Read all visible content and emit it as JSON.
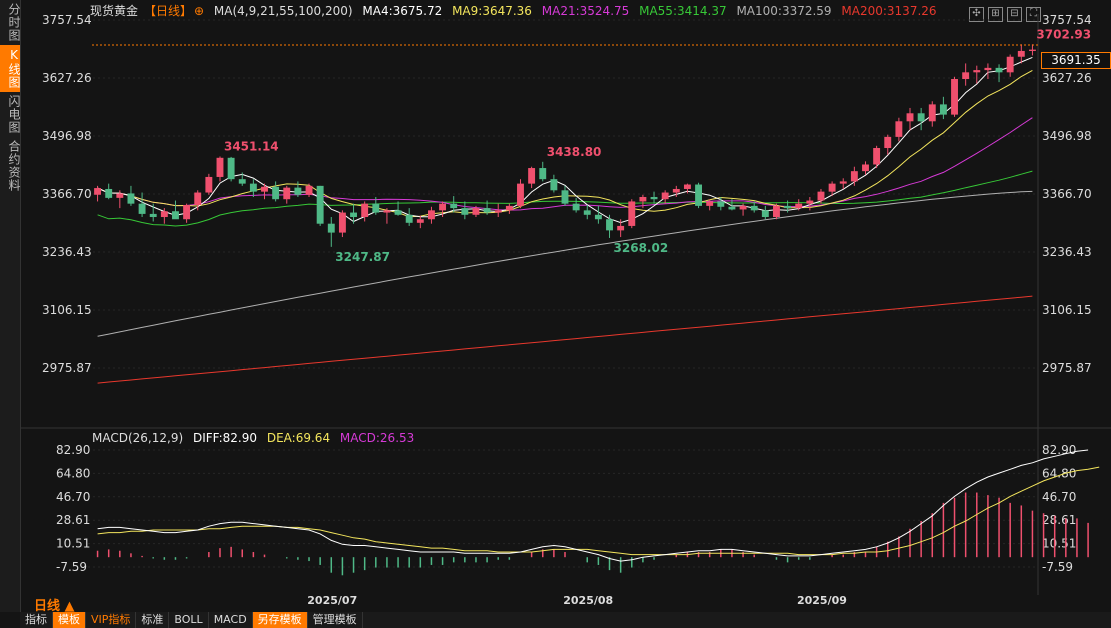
{
  "sidebar": {
    "tabs": [
      "分时图",
      "K线图",
      "闪电图",
      "合约资料"
    ],
    "active": 1
  },
  "header": {
    "symbol": "现货黄金",
    "period_tag": "【日线】",
    "ma_params": "MA(4,9,21,55,100,200)",
    "ma4": "MA4:3675.72",
    "ma9": "MA9:3647.36",
    "ma21": "MA21:3524.75",
    "ma55": "MA55:3414.37",
    "ma100": "MA100:3372.59",
    "ma200": "MA200:3137.26"
  },
  "macd_header": {
    "label": "MACD(26,12,9)",
    "diff": "DIFF:82.90",
    "dea": "DEA:69.64",
    "macd": "MACD:26.53"
  },
  "current_price": "3691.35",
  "period_label": "日线 ▲",
  "bottom_tabs": [
    "指标",
    "模板",
    "VIP指标",
    "标准",
    "BOLL",
    "MACD",
    "另存模板",
    "管理模板"
  ],
  "colors": {
    "up": "#f0506e",
    "down": "#4fb987",
    "ma4": "#ffffff",
    "ma9": "#f3e55d",
    "ma21": "#d63ad6",
    "ma55": "#37c837",
    "ma100": "#b0b0b0",
    "ma200": "#e8382d",
    "accent": "#ff7a00"
  },
  "chart_data": {
    "type": "candlestick",
    "y_ticks": [
      "3757.54",
      "3627.26",
      "3496.98",
      "3366.70",
      "3236.43",
      "3106.15",
      "2975.87"
    ],
    "x_labels": [
      {
        "label": "2025/07",
        "index": 21
      },
      {
        "label": "2025/08",
        "index": 44
      },
      {
        "label": "2025/09",
        "index": 65
      }
    ],
    "ylim": [
      2975.87,
      3757.54
    ],
    "ohlc": [
      [
        3365,
        3385,
        3350,
        3380
      ],
      [
        3378,
        3390,
        3355,
        3358
      ],
      [
        3358,
        3375,
        3335,
        3368
      ],
      [
        3368,
        3385,
        3340,
        3345
      ],
      [
        3345,
        3370,
        3315,
        3322
      ],
      [
        3322,
        3345,
        3305,
        3315
      ],
      [
        3315,
        3335,
        3300,
        3328
      ],
      [
        3328,
        3352,
        3315,
        3310
      ],
      [
        3310,
        3345,
        3302,
        3342
      ],
      [
        3342,
        3375,
        3330,
        3370
      ],
      [
        3370,
        3412,
        3365,
        3405
      ],
      [
        3405,
        3451,
        3395,
        3448
      ],
      [
        3448,
        3450,
        3395,
        3400
      ],
      [
        3400,
        3415,
        3385,
        3390
      ],
      [
        3390,
        3400,
        3360,
        3372
      ],
      [
        3372,
        3390,
        3355,
        3383
      ],
      [
        3383,
        3395,
        3350,
        3355
      ],
      [
        3355,
        3385,
        3345,
        3381
      ],
      [
        3381,
        3395,
        3360,
        3365
      ],
      [
        3365,
        3390,
        3360,
        3385
      ],
      [
        3385,
        3385,
        3295,
        3300
      ],
      [
        3300,
        3315,
        3248,
        3280
      ],
      [
        3280,
        3330,
        3270,
        3325
      ],
      [
        3325,
        3345,
        3300,
        3315
      ],
      [
        3315,
        3350,
        3305,
        3345
      ],
      [
        3345,
        3360,
        3320,
        3325
      ],
      [
        3325,
        3335,
        3300,
        3330
      ],
      [
        3330,
        3350,
        3318,
        3320
      ],
      [
        3320,
        3335,
        3295,
        3302
      ],
      [
        3302,
        3318,
        3290,
        3310
      ],
      [
        3310,
        3338,
        3300,
        3330
      ],
      [
        3330,
        3350,
        3315,
        3345
      ],
      [
        3345,
        3362,
        3325,
        3335
      ],
      [
        3335,
        3350,
        3310,
        3320
      ],
      [
        3320,
        3340,
        3315,
        3335
      ],
      [
        3335,
        3352,
        3320,
        3325
      ],
      [
        3325,
        3345,
        3315,
        3330
      ],
      [
        3330,
        3345,
        3322,
        3340
      ],
      [
        3340,
        3400,
        3335,
        3390
      ],
      [
        3390,
        3428,
        3380,
        3425
      ],
      [
        3425,
        3439,
        3395,
        3400
      ],
      [
        3400,
        3410,
        3370,
        3375
      ],
      [
        3375,
        3385,
        3340,
        3345
      ],
      [
        3345,
        3358,
        3325,
        3330
      ],
      [
        3330,
        3342,
        3310,
        3320
      ],
      [
        3320,
        3340,
        3300,
        3310
      ],
      [
        3310,
        3320,
        3268,
        3285
      ],
      [
        3285,
        3310,
        3270,
        3295
      ],
      [
        3295,
        3355,
        3290,
        3350
      ],
      [
        3350,
        3365,
        3335,
        3360
      ],
      [
        3360,
        3372,
        3345,
        3355
      ],
      [
        3355,
        3375,
        3345,
        3370
      ],
      [
        3370,
        3385,
        3360,
        3378
      ],
      [
        3378,
        3390,
        3368,
        3388
      ],
      [
        3388,
        3392,
        3335,
        3340
      ],
      [
        3340,
        3355,
        3330,
        3350
      ],
      [
        3350,
        3360,
        3330,
        3338
      ],
      [
        3338,
        3355,
        3330,
        3332
      ],
      [
        3332,
        3345,
        3318,
        3340
      ],
      [
        3340,
        3350,
        3325,
        3330
      ],
      [
        3330,
        3340,
        3310,
        3315
      ],
      [
        3315,
        3345,
        3310,
        3340
      ],
      [
        3340,
        3352,
        3325,
        3335
      ],
      [
        3335,
        3355,
        3330,
        3345
      ],
      [
        3345,
        3360,
        3330,
        3352
      ],
      [
        3352,
        3378,
        3345,
        3372
      ],
      [
        3372,
        3395,
        3362,
        3390
      ],
      [
        3390,
        3402,
        3378,
        3395
      ],
      [
        3395,
        3428,
        3385,
        3418
      ],
      [
        3418,
        3440,
        3410,
        3433
      ],
      [
        3433,
        3475,
        3425,
        3470
      ],
      [
        3470,
        3500,
        3455,
        3495
      ],
      [
        3495,
        3538,
        3485,
        3530
      ],
      [
        3530,
        3560,
        3510,
        3548
      ],
      [
        3548,
        3560,
        3510,
        3530
      ],
      [
        3530,
        3575,
        3518,
        3568
      ],
      [
        3568,
        3585,
        3535,
        3545
      ],
      [
        3545,
        3630,
        3540,
        3625
      ],
      [
        3625,
        3660,
        3610,
        3640
      ],
      [
        3640,
        3655,
        3615,
        3645
      ],
      [
        3645,
        3660,
        3625,
        3650
      ],
      [
        3650,
        3658,
        3618,
        3640
      ],
      [
        3640,
        3680,
        3630,
        3675
      ],
      [
        3675,
        3703,
        3660,
        3688
      ],
      [
        3688,
        3703,
        3678,
        3691
      ]
    ],
    "annotations": [
      {
        "text": "3451.14",
        "index": 11,
        "value": 3451.14,
        "pos": "high"
      },
      {
        "text": "3247.87",
        "index": 21,
        "value": 3247.87,
        "pos": "low"
      },
      {
        "text": "3438.80",
        "index": 40,
        "value": 3438.8,
        "pos": "high"
      },
      {
        "text": "3268.02",
        "index": 46,
        "value": 3268.02,
        "pos": "low"
      },
      {
        "text": "3702.93",
        "index": 84,
        "value": 3702.93,
        "pos": "high"
      }
    ],
    "ma200": {
      "start": 2942,
      "end": 3137.26
    },
    "ma100": {
      "start": 3047,
      "end": 3372.59
    },
    "macd": {
      "y_ticks": [
        "82.90",
        "64.80",
        "46.70",
        "28.61",
        "10.51",
        "-7.59"
      ],
      "ylim": [
        -7.59,
        82.9
      ],
      "diff": [
        22,
        23,
        23,
        22,
        21,
        20,
        19,
        19,
        20,
        21,
        24,
        26,
        27,
        27,
        26,
        25,
        24,
        23,
        22,
        21,
        18,
        13,
        10,
        9,
        9,
        8,
        7,
        6,
        5,
        4,
        4,
        4,
        4,
        3,
        3,
        3,
        3,
        3,
        4,
        6,
        8,
        9,
        8,
        6,
        4,
        2,
        -1,
        -3,
        -2,
        0,
        1,
        2,
        3,
        4,
        5,
        5,
        6,
        6,
        5,
        4,
        3,
        2,
        1,
        1,
        1,
        2,
        3,
        4,
        5,
        6,
        8,
        11,
        15,
        20,
        26,
        32,
        40,
        47,
        53,
        58,
        62,
        65,
        68,
        71,
        73,
        76,
        78,
        80,
        82,
        82.9
      ],
      "dea": [
        18,
        19,
        19,
        20,
        20,
        21,
        21,
        21,
        21,
        21,
        22,
        22,
        23,
        24,
        24,
        24,
        24,
        23,
        23,
        22,
        21,
        19,
        17,
        15,
        14,
        12,
        11,
        10,
        9,
        8,
        7,
        7,
        6,
        5,
        5,
        5,
        4,
        4,
        4,
        4,
        5,
        6,
        6,
        6,
        6,
        5,
        4,
        3,
        2,
        2,
        2,
        2,
        2,
        2,
        3,
        3,
        3,
        3,
        3,
        3,
        3,
        3,
        3,
        2,
        2,
        2,
        2,
        3,
        3,
        4,
        4,
        5,
        7,
        9,
        12,
        15,
        19,
        24,
        28,
        33,
        38,
        42,
        47,
        51,
        55,
        59,
        62,
        65,
        67,
        68,
        69.64
      ],
      "hist": [
        5,
        6,
        5,
        3,
        1,
        -1,
        -2,
        -2,
        -1,
        0,
        4,
        7,
        8,
        6,
        4,
        2,
        0,
        -1,
        -2,
        -3,
        -6,
        -12,
        -14,
        -12,
        -10,
        -8,
        -8,
        -8,
        -8,
        -8,
        -6,
        -6,
        -4,
        -4,
        -4,
        -4,
        -2,
        -2,
        0,
        4,
        6,
        6,
        4,
        0,
        -4,
        -6,
        -10,
        -12,
        -8,
        -4,
        -2,
        0,
        2,
        4,
        4,
        4,
        6,
        6,
        4,
        2,
        0,
        -2,
        -4,
        -2,
        -2,
        0,
        2,
        2,
        4,
        4,
        8,
        12,
        16,
        22,
        28,
        34,
        42,
        46,
        50,
        50,
        48,
        46,
        42,
        40,
        36,
        34,
        32,
        30,
        30,
        26.53
      ]
    }
  }
}
